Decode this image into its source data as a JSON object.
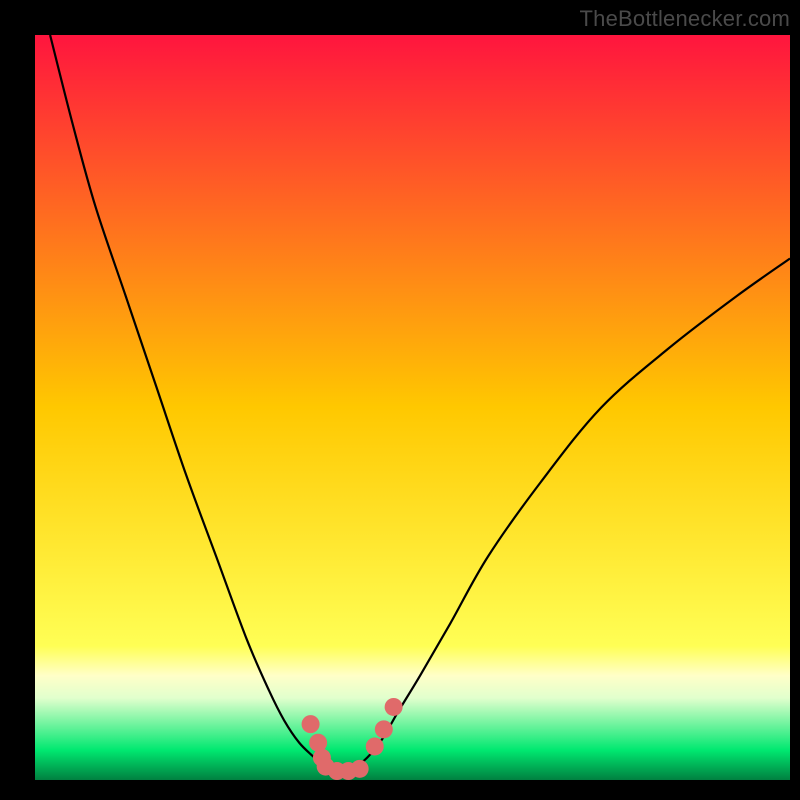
{
  "watermark": "TheBottlenecker.com",
  "chart_data": {
    "type": "line",
    "title": "",
    "xlabel": "",
    "ylabel": "",
    "xlim": [
      0,
      100
    ],
    "ylim": [
      0,
      100
    ],
    "background": {
      "gradient_stops": [
        {
          "pos": 0.0,
          "color": "#ff153e"
        },
        {
          "pos": 0.5,
          "color": "#ffc800"
        },
        {
          "pos": 0.82,
          "color": "#ffff55"
        },
        {
          "pos": 0.86,
          "color": "#ffffc8"
        },
        {
          "pos": 0.89,
          "color": "#e1ffcd"
        },
        {
          "pos": 0.96,
          "color": "#00e870"
        },
        {
          "pos": 1.0,
          "color": "#008040"
        }
      ]
    },
    "frame": {
      "inner_x": 35,
      "inner_y": 35,
      "inner_w": 755,
      "inner_h": 745
    },
    "series": [
      {
        "name": "bottleneck-curve",
        "color": "#000000",
        "x": [
          2,
          5,
          8,
          12,
          16,
          20,
          24,
          28,
          31,
          33,
          35,
          37,
          38.5,
          40,
          42,
          44,
          46,
          48,
          51,
          55,
          60,
          67,
          75,
          84,
          93,
          100
        ],
        "y": [
          100,
          88,
          77,
          65,
          53,
          41,
          30,
          19,
          12,
          8,
          5,
          3,
          1.5,
          1,
          1.5,
          3,
          5.5,
          9,
          14,
          21,
          30,
          40,
          50,
          58,
          65,
          70
        ]
      }
    ],
    "markers": {
      "name": "highlight-dots",
      "color": "#e06a6a",
      "points": [
        {
          "x": 36.5,
          "y": 7.5
        },
        {
          "x": 37.5,
          "y": 5.0
        },
        {
          "x": 38.0,
          "y": 3.0
        },
        {
          "x": 38.5,
          "y": 1.8
        },
        {
          "x": 40.0,
          "y": 1.2
        },
        {
          "x": 41.5,
          "y": 1.2
        },
        {
          "x": 43.0,
          "y": 1.5
        },
        {
          "x": 45.0,
          "y": 4.5
        },
        {
          "x": 46.2,
          "y": 6.8
        },
        {
          "x": 47.5,
          "y": 9.8
        }
      ],
      "radius": 9
    }
  }
}
